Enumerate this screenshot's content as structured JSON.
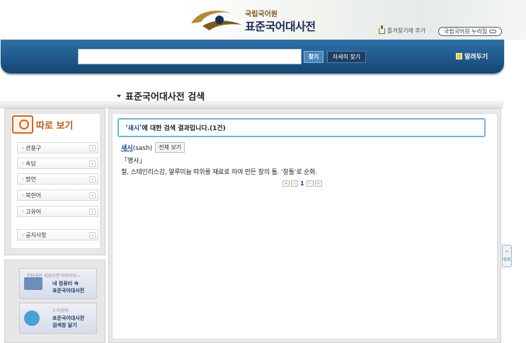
{
  "header": {
    "org_name": "국립국어원",
    "site_name": "표준국어대사전",
    "favorite_label": "즐겨찾기에 추가",
    "nuri_label": "국립국어원 누리집"
  },
  "search": {
    "value": "",
    "find_label": "찾기",
    "advanced_label": "자세히 찾기",
    "notice_label": "알려두기"
  },
  "page_title": "표준국어대사전 검색",
  "sidebar": {
    "title": "따로 보기",
    "items": [
      {
        "label": "· 관용구"
      },
      {
        "label": "· 속담"
      },
      {
        "label": "· 방언"
      },
      {
        "label": "· 북한어"
      },
      {
        "label": "· 고유어"
      },
      {
        "label": "· 공지사항"
      }
    ],
    "arrow": "›"
  },
  "promo": [
    {
      "line1": "인터넷만 지원되면 바로바로~",
      "line2": "내 컴퓨터 속",
      "line3": "표준국어대사전"
    },
    {
      "line1": "누리집에",
      "line2": "표준국어대사전",
      "line3": "검색창 달기"
    }
  ],
  "result": {
    "quote_open": "‘",
    "query": "새시",
    "quote_close": "’",
    "summary_text": "에 대한 검색 결과입니다.(1건)",
    "entry": {
      "word": "새시",
      "origin": "(sash)",
      "full_view_label": "전체 보기",
      "pos": "「명사」",
      "definition": "철, 스테인리스강, 알루미늄 따위를 재료로 하여 만든 창의 틀. ‘창틀’로 순화."
    },
    "pager": {
      "first": "«",
      "prev": "‹",
      "current": "1",
      "next": "›",
      "last": "»"
    }
  },
  "side_tab": {
    "label": "위로",
    "chevron": "^"
  },
  "colors": {
    "search_bar": "#1f5689",
    "accent_orange": "#b75a1c",
    "link_blue": "#1d3f8f",
    "result_border": "#7ab3cf"
  }
}
